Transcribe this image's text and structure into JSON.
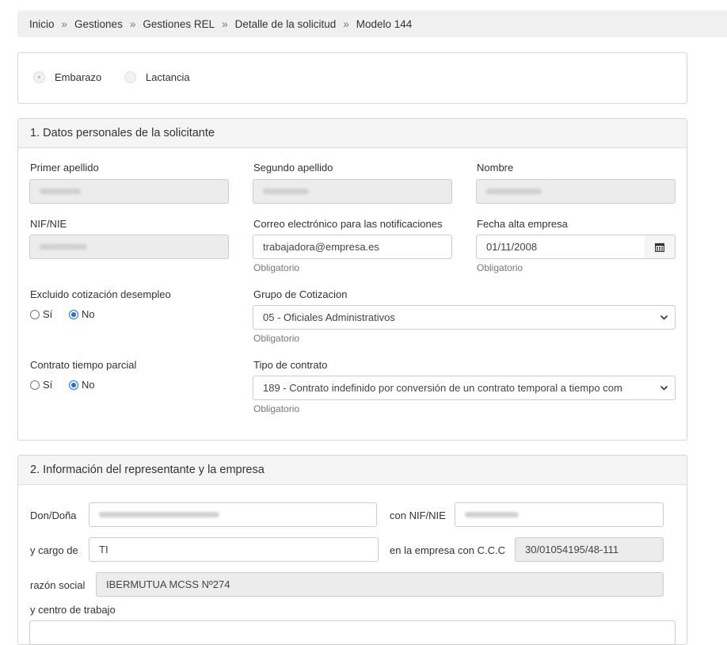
{
  "breadcrumb": {
    "items": [
      "Inicio",
      "Gestiones",
      "Gestiones REL",
      "Detalle de la solicitud",
      "Modelo 144"
    ],
    "separator": "»"
  },
  "type_selector": {
    "options": [
      {
        "label": "Embarazo",
        "selected": true
      },
      {
        "label": "Lactancia",
        "selected": false
      }
    ]
  },
  "section1": {
    "title": "1. Datos personales de la solicitante",
    "primer_apellido": {
      "label": "Primer apellido"
    },
    "segundo_apellido": {
      "label": "Segundo apellido"
    },
    "nombre": {
      "label": "Nombre"
    },
    "nif": {
      "label": "NIF/NIE"
    },
    "correo": {
      "label": "Correo electrónico para las notificaciones",
      "value": "trabajadora@empresa.es",
      "help": "Obligatorio"
    },
    "fecha_alta": {
      "label": "Fecha alta empresa",
      "value": "01/11/2008",
      "help": "Obligatorio"
    },
    "excluido": {
      "label": "Excluido cotización desempleo",
      "options": [
        "Sí",
        "No"
      ],
      "selected": "No"
    },
    "grupo": {
      "label": "Grupo de Cotizacion",
      "value": "05 - Oficiales Administrativos",
      "help": "Obligatorio"
    },
    "parcial": {
      "label": "Contrato tiempo parcial",
      "options": [
        "Sí",
        "No"
      ],
      "selected": "No"
    },
    "tipo": {
      "label": "Tipo de contrato",
      "value": "189 - Contrato indefinido por conversión de un contrato temporal a tiempo com",
      "help": "Obligatorio"
    }
  },
  "section2": {
    "title": "2. Información del representante y la empresa",
    "don_label": "Don/Doña",
    "con_nif_label": "con NIF/NIE",
    "cargo_label": "y cargo de",
    "cargo_value": "TI",
    "ccc_label": "en la empresa con C.C.C",
    "ccc_value": "30/01054195/48-111",
    "razon_label": "razón social",
    "razon_value": "IBERMUTUA MCSS Nº274",
    "centro_label": "y centro de trabajo"
  },
  "colors": {
    "accent": "#1a73e8",
    "readonly_bg": "#ececec",
    "panel_head_bg": "#f5f5f5"
  },
  "icons": {
    "calendar": "calendar-icon",
    "select": "chevron-down-icon"
  }
}
